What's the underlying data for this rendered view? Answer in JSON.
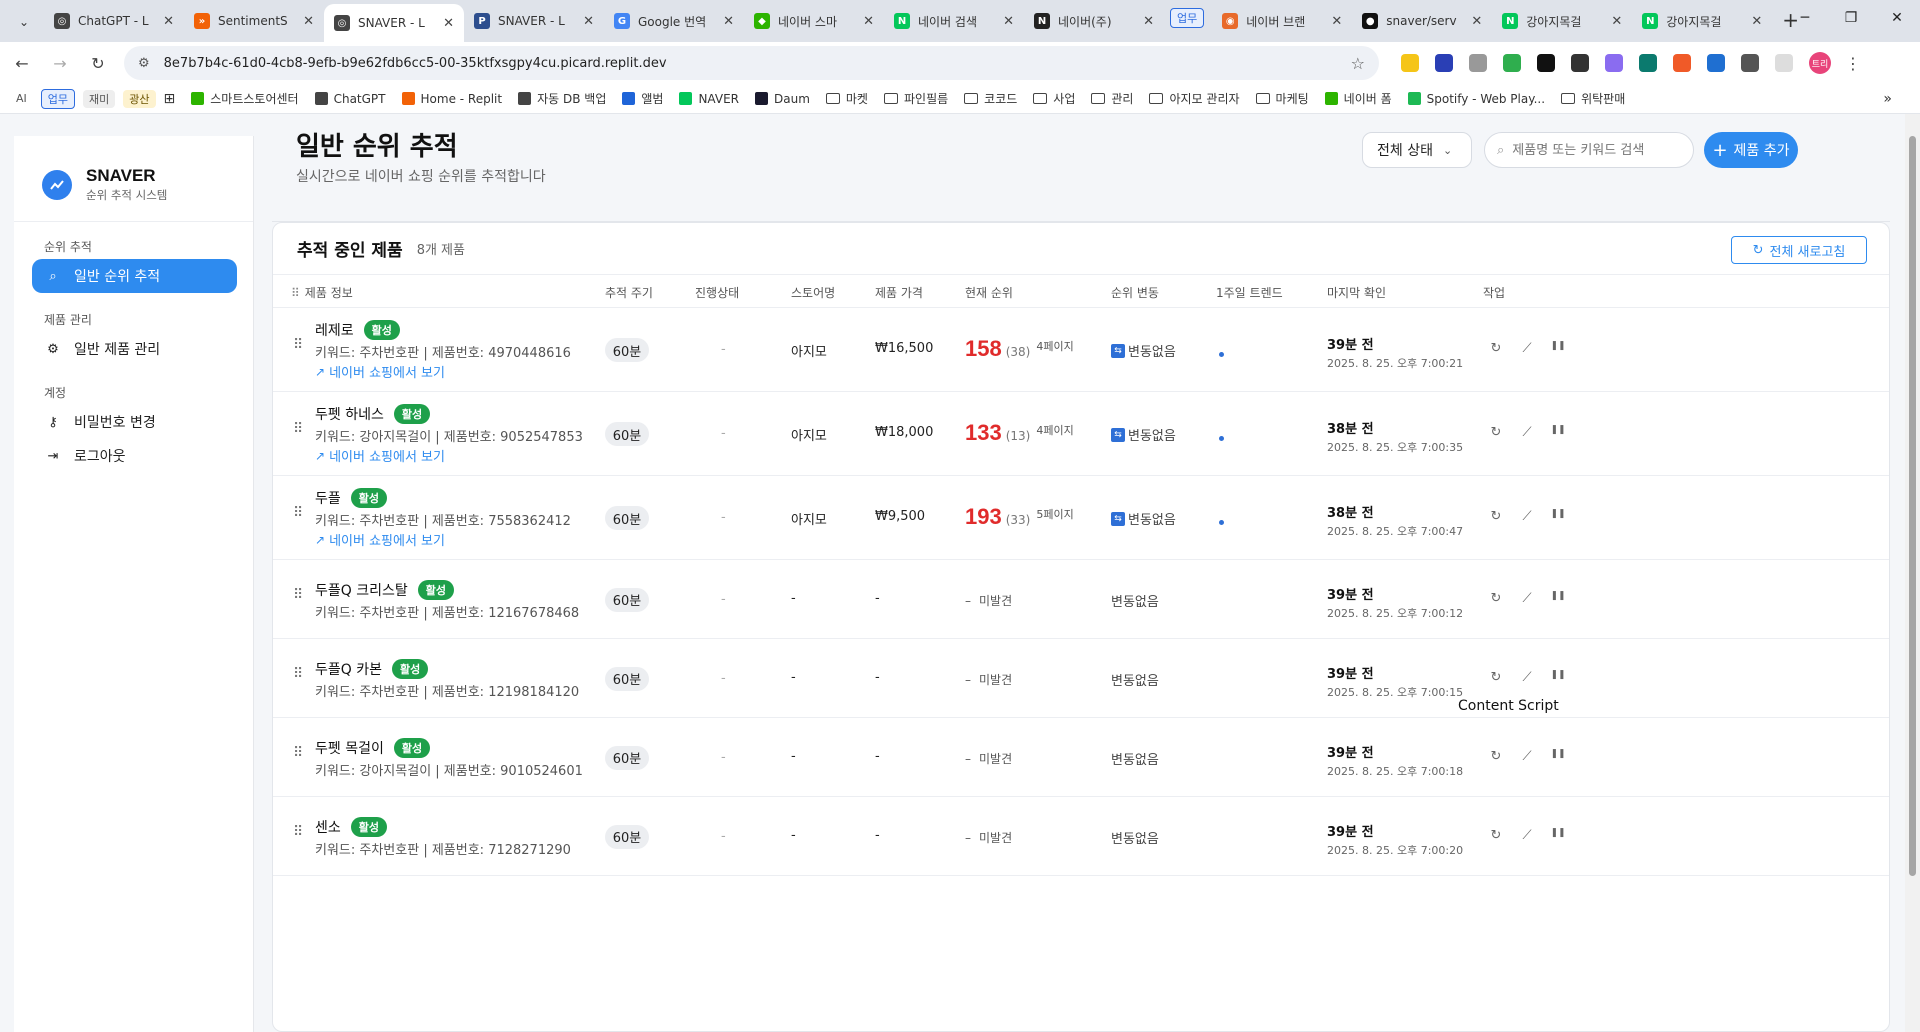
{
  "browser": {
    "tabs": [
      {
        "title": "ChatGPT - L",
        "color": "#444444",
        "glyph": "◎"
      },
      {
        "title": "SentimentS",
        "color": "#f26207",
        "glyph": "»"
      },
      {
        "title": "SNAVER - L",
        "color": "#444444",
        "glyph": "◎",
        "active": true
      },
      {
        "title": "SNAVER - L",
        "color": "#2d4e8e",
        "glyph": "P"
      },
      {
        "title": "Google 번역",
        "color": "#4285f4",
        "glyph": "G"
      },
      {
        "title": "네이버 스마",
        "color": "#2db400",
        "glyph": "◆"
      },
      {
        "title": "네이버 검색",
        "color": "#03c75a",
        "glyph": "N"
      },
      {
        "title": "네이버(주)",
        "color": "#222222",
        "glyph": "N"
      },
      {
        "title": "네이버 브랜",
        "color": "#e86a2a",
        "glyph": "◉",
        "group": "업무"
      },
      {
        "title": "snaver/serv",
        "color": "#111111",
        "glyph": "●"
      },
      {
        "title": "강아지목걸",
        "color": "#03c75a",
        "glyph": "N"
      },
      {
        "title": "강아지목걸",
        "color": "#03c75a",
        "glyph": "N"
      }
    ],
    "url": "8e7b7b4c-61d0-4cb8-9efb-b9e62fdb6cc5-00-35ktfxsgpy4cu.picard.replit.dev",
    "profile": "트리",
    "chips": [
      "AI",
      "업무",
      "재미",
      "광산"
    ],
    "bookmarks": [
      {
        "label": "스마트스토어센터",
        "icon": "#2db400"
      },
      {
        "label": "ChatGPT",
        "icon": "#444444"
      },
      {
        "label": "Home - Replit",
        "icon": "#f26207"
      },
      {
        "label": "자동 DB 백업",
        "icon": "#444444"
      },
      {
        "label": "앨범",
        "icon": "#1e64d8"
      },
      {
        "label": "NAVER",
        "icon": "#03c75a"
      },
      {
        "label": "Daum",
        "icon": "#1a1a2e"
      },
      {
        "label": "마켓",
        "folder": true
      },
      {
        "label": "파인필름",
        "folder": true
      },
      {
        "label": "코코드",
        "folder": true
      },
      {
        "label": "사업",
        "folder": true
      },
      {
        "label": "관리",
        "folder": true
      },
      {
        "label": "아지모 관리자",
        "folder": true
      },
      {
        "label": "마케팅",
        "folder": true
      },
      {
        "label": "네이버 폼",
        "icon": "#2db400"
      },
      {
        "label": "Spotify - Web Play...",
        "icon": "#1db954"
      },
      {
        "label": "위탁판매",
        "folder": true
      }
    ]
  },
  "sidebar": {
    "brand": "SNAVER",
    "brand_sub": "순위 추적 시스템",
    "sections": [
      {
        "title": "순위 추적",
        "items": [
          {
            "label": "일반 순위 추적",
            "icon": "search-icon",
            "active": true
          }
        ]
      },
      {
        "title": "제품 관리",
        "items": [
          {
            "label": "일반 제품 관리",
            "icon": "gears-icon"
          }
        ]
      },
      {
        "title": "계정",
        "items": [
          {
            "label": "비밀번호 변경",
            "icon": "key-icon"
          },
          {
            "label": "로그아웃",
            "icon": "logout-icon"
          }
        ]
      }
    ]
  },
  "header": {
    "title": "일반 순위 추적",
    "subtitle": "실시간으로 네이버 쇼핑 순위를 추적합니다",
    "status_filter": "전체 상태",
    "search_placeholder": "제품명 또는 키워드 검색",
    "add_label": "제품 추가"
  },
  "panel": {
    "title": "추적 중인 제품",
    "count": "8개 제품",
    "refresh_all": "전체 새로고침",
    "columns": [
      "제품 정보",
      "추적 주기",
      "진행상태",
      "스토어명",
      "제품 가격",
      "현재 순위",
      "순위 변동",
      "1주일 트렌드",
      "마지막 확인",
      "작업"
    ]
  },
  "products": [
    {
      "name": "레제로",
      "badge": "활성",
      "keyword": "키워드: 주차번호판 | 제품번호: 4970448616",
      "link": "네이버 쇼핑에서 보기",
      "cycle": "60분",
      "status": "-",
      "store": "아지모",
      "price": "₩16,500",
      "rank": "158",
      "rank_sub": "(38)",
      "page": "4페이지",
      "change": "변동없음",
      "trend": true,
      "ago": "39분 전",
      "ts": "2025. 8. 25. 오후 7:00:21"
    },
    {
      "name": "두펫 하네스",
      "badge": "활성",
      "keyword": "키워드: 강아지목걸이 | 제품번호: 9052547853",
      "link": "네이버 쇼핑에서 보기",
      "cycle": "60분",
      "status": "-",
      "store": "아지모",
      "price": "₩18,000",
      "rank": "133",
      "rank_sub": "(13)",
      "page": "4페이지",
      "change": "변동없음",
      "trend": true,
      "ago": "38분 전",
      "ts": "2025. 8. 25. 오후 7:00:35"
    },
    {
      "name": "두플",
      "badge": "활성",
      "keyword": "키워드: 주차번호판 | 제품번호: 7558362412",
      "link": "네이버 쇼핑에서 보기",
      "cycle": "60분",
      "status": "-",
      "store": "아지모",
      "price": "₩9,500",
      "rank": "193",
      "rank_sub": "(33)",
      "page": "5페이지",
      "change": "변동없음",
      "trend": true,
      "ago": "38분 전",
      "ts": "2025. 8. 25. 오후 7:00:47"
    },
    {
      "name": "두플Q 크리스탈",
      "badge": "활성",
      "keyword": "키워드: 주차번호판 | 제품번호: 12167678468",
      "cycle": "60분",
      "status": "-",
      "store": "-",
      "price": "-",
      "rank_none": "미발견",
      "change": "변동없음",
      "ago": "39분 전",
      "ts": "2025. 8. 25. 오후 7:00:12"
    },
    {
      "name": "두플Q 카본",
      "badge": "활성",
      "keyword": "키워드: 주차번호판 | 제품번호: 12198184120",
      "cycle": "60분",
      "status": "-",
      "store": "-",
      "price": "-",
      "rank_none": "미발견",
      "change": "변동없음",
      "ago": "39분 전",
      "ts": "2025. 8. 25. 오후 7:00:15"
    },
    {
      "name": "두펫 목걸이",
      "badge": "활성",
      "keyword": "키워드: 강아지목걸이 | 제품번호: 9010524601",
      "cycle": "60분",
      "status": "-",
      "store": "-",
      "price": "-",
      "rank_none": "미발견",
      "change": "변동없음",
      "ago": "39분 전",
      "ts": "2025. 8. 25. 오후 7:00:18"
    },
    {
      "name": "센소",
      "badge": "활성",
      "keyword": "키워드: 주차번호판 | 제품번호: 7128271290",
      "cycle": "60분",
      "status": "-",
      "store": "-",
      "price": "-",
      "rank_none": "미발견",
      "change": "변동없음",
      "ago": "39분 전",
      "ts": "2025. 8. 25. 오후 7:00:20"
    }
  ],
  "overlay": "Content Script",
  "colors": {
    "accent": "#2e8bef",
    "active_badge": "#1ea04a",
    "rank": "#e02b2b"
  }
}
